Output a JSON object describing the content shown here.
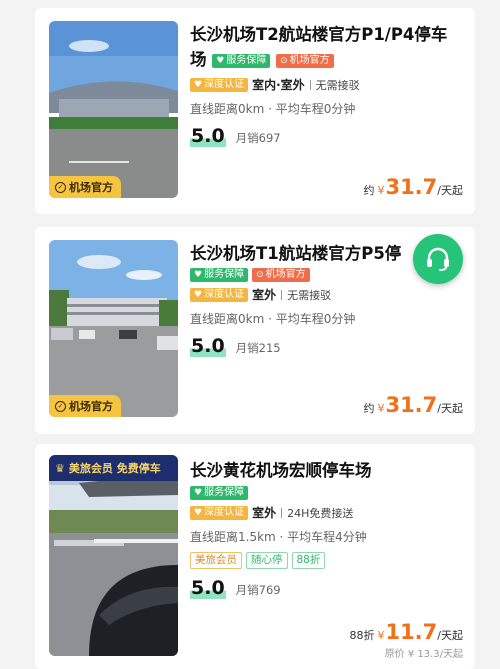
{
  "listings": [
    {
      "title": "长沙机场T2航站楼官方P1/P4停车场",
      "badge": "机场官方",
      "tags": [
        "服务保障",
        "机场官方"
      ],
      "certified": "深度认证",
      "location_type": "室内·室外",
      "shuttle": "无需接驳",
      "distance": "直线距离0km · 平均车程0分钟",
      "score": "5.0",
      "sales": "月销697",
      "price_prefix": "约",
      "currency": "¥",
      "price": "31.7",
      "unit": "/天起"
    },
    {
      "title": "长沙机场T1航站楼官方P5停",
      "badge": "机场官方",
      "tags": [
        "服务保障",
        "机场官方"
      ],
      "certified": "深度认证",
      "location_type": "室外",
      "shuttle": "无需接驳",
      "distance": "直线距离0km · 平均车程0分钟",
      "score": "5.0",
      "sales": "月销215",
      "price_prefix": "约",
      "currency": "¥",
      "price": "31.7",
      "unit": "/天起"
    },
    {
      "title": "长沙黄花机场宏顺停车场",
      "promo": "美旅会员 免费停车",
      "tags": [
        "服务保障"
      ],
      "certified": "深度认证",
      "location_type": "室外",
      "shuttle": "24H免费接送",
      "distance": "直线距离1.5km · 平均车程4分钟",
      "chips": [
        "美旅会员",
        "随心停",
        "88折"
      ],
      "score": "5.0",
      "sales": "月销769",
      "price_prefix": "88折",
      "currency": "¥",
      "price": "11.7",
      "unit": "/天起",
      "original_price": "原价 ¥ 13.3/天起"
    }
  ],
  "colors": {
    "accent_orange": "#f0711a",
    "green": "#2eb86b",
    "red": "#f06d4a",
    "gold": "#f3b640"
  },
  "floating": {
    "icon": "headset-icon"
  }
}
